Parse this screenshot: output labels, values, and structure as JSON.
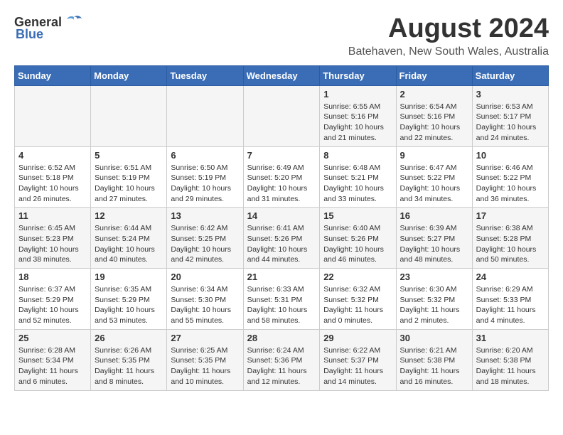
{
  "header": {
    "logo_general": "General",
    "logo_blue": "Blue",
    "title": "August 2024",
    "subtitle": "Batehaven, New South Wales, Australia"
  },
  "days_of_week": [
    "Sunday",
    "Monday",
    "Tuesday",
    "Wednesday",
    "Thursday",
    "Friday",
    "Saturday"
  ],
  "weeks": [
    {
      "days": [
        {
          "num": "",
          "detail": ""
        },
        {
          "num": "",
          "detail": ""
        },
        {
          "num": "",
          "detail": ""
        },
        {
          "num": "",
          "detail": ""
        },
        {
          "num": "1",
          "detail": "Sunrise: 6:55 AM\nSunset: 5:16 PM\nDaylight: 10 hours\nand 21 minutes."
        },
        {
          "num": "2",
          "detail": "Sunrise: 6:54 AM\nSunset: 5:16 PM\nDaylight: 10 hours\nand 22 minutes."
        },
        {
          "num": "3",
          "detail": "Sunrise: 6:53 AM\nSunset: 5:17 PM\nDaylight: 10 hours\nand 24 minutes."
        }
      ]
    },
    {
      "days": [
        {
          "num": "4",
          "detail": "Sunrise: 6:52 AM\nSunset: 5:18 PM\nDaylight: 10 hours\nand 26 minutes."
        },
        {
          "num": "5",
          "detail": "Sunrise: 6:51 AM\nSunset: 5:19 PM\nDaylight: 10 hours\nand 27 minutes."
        },
        {
          "num": "6",
          "detail": "Sunrise: 6:50 AM\nSunset: 5:19 PM\nDaylight: 10 hours\nand 29 minutes."
        },
        {
          "num": "7",
          "detail": "Sunrise: 6:49 AM\nSunset: 5:20 PM\nDaylight: 10 hours\nand 31 minutes."
        },
        {
          "num": "8",
          "detail": "Sunrise: 6:48 AM\nSunset: 5:21 PM\nDaylight: 10 hours\nand 33 minutes."
        },
        {
          "num": "9",
          "detail": "Sunrise: 6:47 AM\nSunset: 5:22 PM\nDaylight: 10 hours\nand 34 minutes."
        },
        {
          "num": "10",
          "detail": "Sunrise: 6:46 AM\nSunset: 5:22 PM\nDaylight: 10 hours\nand 36 minutes."
        }
      ]
    },
    {
      "days": [
        {
          "num": "11",
          "detail": "Sunrise: 6:45 AM\nSunset: 5:23 PM\nDaylight: 10 hours\nand 38 minutes."
        },
        {
          "num": "12",
          "detail": "Sunrise: 6:44 AM\nSunset: 5:24 PM\nDaylight: 10 hours\nand 40 minutes."
        },
        {
          "num": "13",
          "detail": "Sunrise: 6:42 AM\nSunset: 5:25 PM\nDaylight: 10 hours\nand 42 minutes."
        },
        {
          "num": "14",
          "detail": "Sunrise: 6:41 AM\nSunset: 5:26 PM\nDaylight: 10 hours\nand 44 minutes."
        },
        {
          "num": "15",
          "detail": "Sunrise: 6:40 AM\nSunset: 5:26 PM\nDaylight: 10 hours\nand 46 minutes."
        },
        {
          "num": "16",
          "detail": "Sunrise: 6:39 AM\nSunset: 5:27 PM\nDaylight: 10 hours\nand 48 minutes."
        },
        {
          "num": "17",
          "detail": "Sunrise: 6:38 AM\nSunset: 5:28 PM\nDaylight: 10 hours\nand 50 minutes."
        }
      ]
    },
    {
      "days": [
        {
          "num": "18",
          "detail": "Sunrise: 6:37 AM\nSunset: 5:29 PM\nDaylight: 10 hours\nand 52 minutes."
        },
        {
          "num": "19",
          "detail": "Sunrise: 6:35 AM\nSunset: 5:29 PM\nDaylight: 10 hours\nand 53 minutes."
        },
        {
          "num": "20",
          "detail": "Sunrise: 6:34 AM\nSunset: 5:30 PM\nDaylight: 10 hours\nand 55 minutes."
        },
        {
          "num": "21",
          "detail": "Sunrise: 6:33 AM\nSunset: 5:31 PM\nDaylight: 10 hours\nand 58 minutes."
        },
        {
          "num": "22",
          "detail": "Sunrise: 6:32 AM\nSunset: 5:32 PM\nDaylight: 11 hours\nand 0 minutes."
        },
        {
          "num": "23",
          "detail": "Sunrise: 6:30 AM\nSunset: 5:32 PM\nDaylight: 11 hours\nand 2 minutes."
        },
        {
          "num": "24",
          "detail": "Sunrise: 6:29 AM\nSunset: 5:33 PM\nDaylight: 11 hours\nand 4 minutes."
        }
      ]
    },
    {
      "days": [
        {
          "num": "25",
          "detail": "Sunrise: 6:28 AM\nSunset: 5:34 PM\nDaylight: 11 hours\nand 6 minutes."
        },
        {
          "num": "26",
          "detail": "Sunrise: 6:26 AM\nSunset: 5:35 PM\nDaylight: 11 hours\nand 8 minutes."
        },
        {
          "num": "27",
          "detail": "Sunrise: 6:25 AM\nSunset: 5:35 PM\nDaylight: 11 hours\nand 10 minutes."
        },
        {
          "num": "28",
          "detail": "Sunrise: 6:24 AM\nSunset: 5:36 PM\nDaylight: 11 hours\nand 12 minutes."
        },
        {
          "num": "29",
          "detail": "Sunrise: 6:22 AM\nSunset: 5:37 PM\nDaylight: 11 hours\nand 14 minutes."
        },
        {
          "num": "30",
          "detail": "Sunrise: 6:21 AM\nSunset: 5:38 PM\nDaylight: 11 hours\nand 16 minutes."
        },
        {
          "num": "31",
          "detail": "Sunrise: 6:20 AM\nSunset: 5:38 PM\nDaylight: 11 hours\nand 18 minutes."
        }
      ]
    }
  ]
}
